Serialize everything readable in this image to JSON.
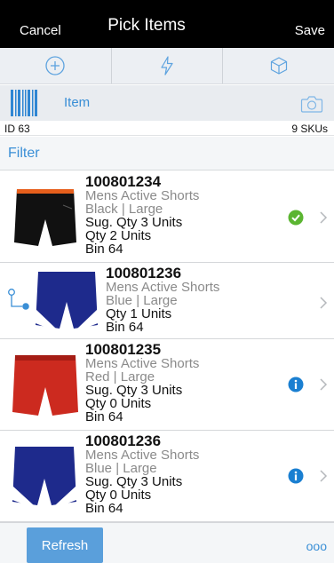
{
  "header": {
    "cancel": "Cancel",
    "title": "Pick Items",
    "save": "Save"
  },
  "toolbar": [
    {
      "icon": "add-circle-icon"
    },
    {
      "icon": "lightning-icon"
    },
    {
      "icon": "cube-icon"
    }
  ],
  "scan": {
    "label": "Item"
  },
  "summary": {
    "id": "ID 63",
    "skus": "9 SKUs"
  },
  "filter": {
    "label": "Filter"
  },
  "items": [
    {
      "code": "100801234",
      "name": "Mens Active Shorts",
      "variant": "Black | Large",
      "sug_qty": "Sug. Qty  3  Units",
      "qty": "Qty  2  Units",
      "bin": "Bin  64",
      "status": "complete-check"
    },
    {
      "code": "100801236",
      "name": "Mens Active Shorts",
      "variant": "Blue | Large",
      "qty": "Qty  1  Units",
      "bin": "Bin  64",
      "status": "none"
    },
    {
      "code": "100801235",
      "name": "Mens Active Shorts",
      "variant": "Red | Large",
      "sug_qty": "Sug. Qty  3  Units",
      "qty": "Qty  0  Units",
      "bin": "Bin  64",
      "status": "info"
    },
    {
      "code": "100801236",
      "name": "Mens Active Shorts",
      "variant": "Blue | Large",
      "sug_qty": "Sug. Qty  3  Units",
      "qty": "Qty  0  Units",
      "bin": "Bin  64",
      "status": "info"
    }
  ],
  "footer": {
    "refresh": "Refresh",
    "more": "ooo"
  },
  "colors": {
    "accent": "#3a8fd6",
    "check": "#5bb531",
    "info": "#1a7fd1"
  }
}
